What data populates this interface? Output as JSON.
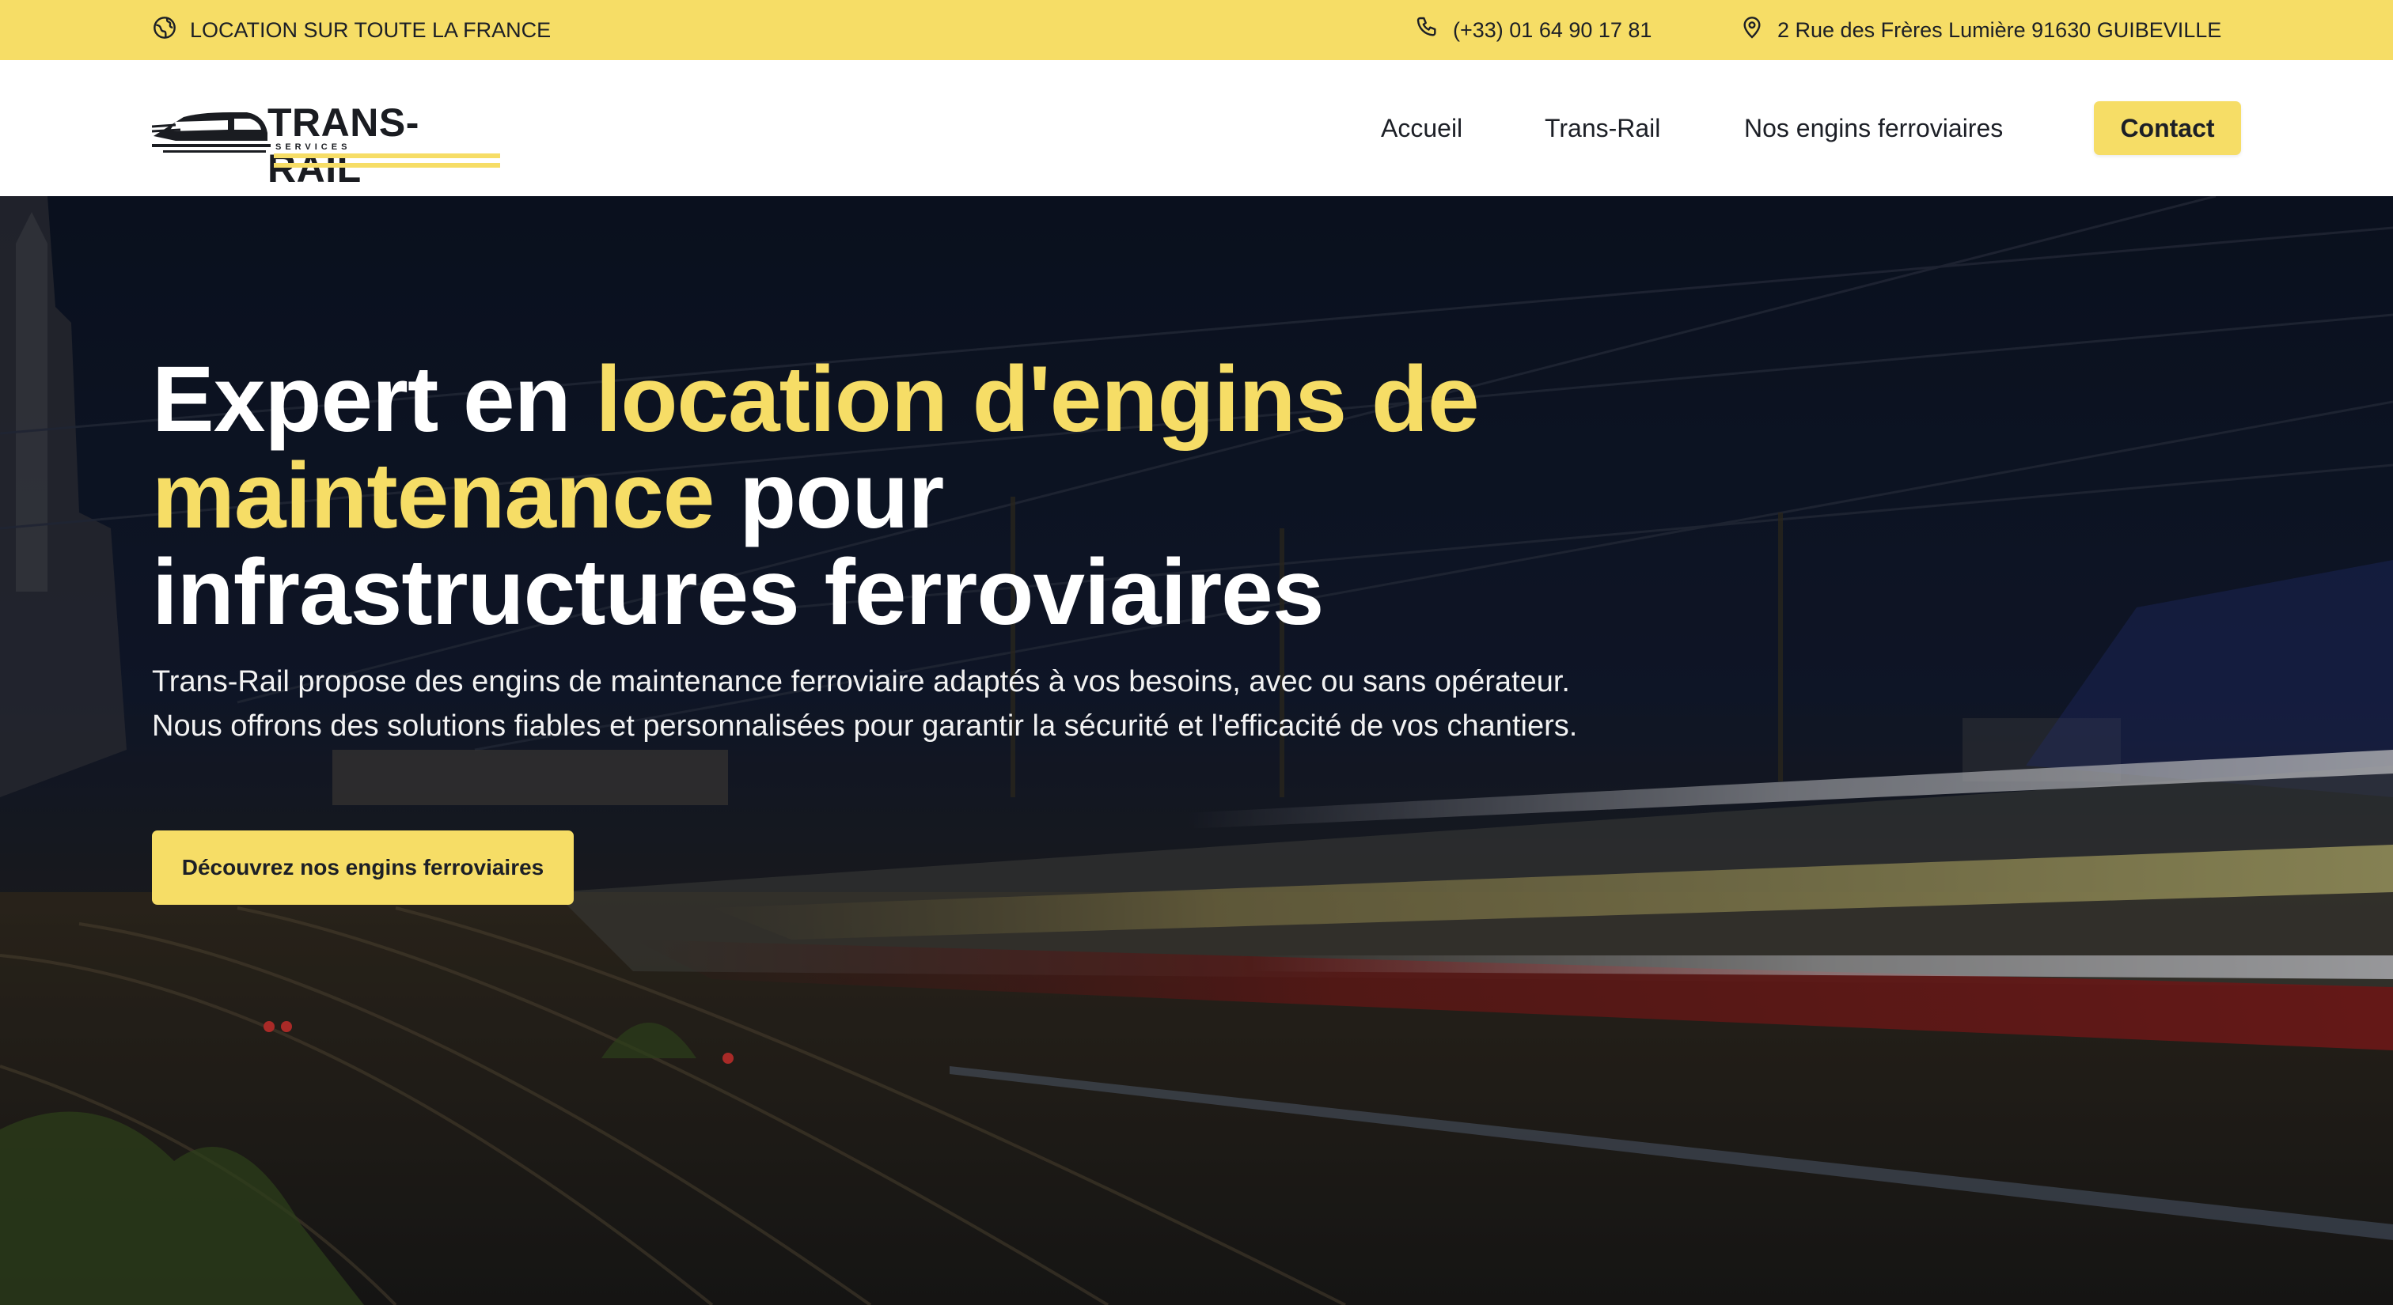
{
  "colors": {
    "accent": "#f6dd66",
    "text_dark": "#1c1f26",
    "header_bg": "#ffffff",
    "hero_text": "#ffffff"
  },
  "topbar": {
    "location_icon": "globe-icon",
    "location_text": "LOCATION SUR TOUTE LA FRANCE",
    "phone_icon": "phone-icon",
    "phone_text": "(+33) 01 64 90 17 81",
    "address_icon": "map-pin-icon",
    "address_text": "2 Rue des Frères Lumière 91630 GUIBEVILLE"
  },
  "header": {
    "logo": {
      "name": "TRANS-RAIL",
      "subtitle": "SERVICES",
      "icon": "train-icon"
    },
    "nav": {
      "accueil": "Accueil",
      "trans_rail": "Trans-Rail",
      "engins": "Nos engins ferroviaires",
      "contact": "Contact"
    }
  },
  "hero": {
    "title_part1": "Expert en ",
    "title_highlight": "location d'engins de maintenance",
    "title_part2": " pour infrastructures ferroviaires",
    "description": "Trans-Rail propose des engins de maintenance ferroviaire adaptés à vos besoins, avec ou sans opérateur. Nous offrons des solutions fiables et personnalisées pour garantir la sécurité et l'efficacité de vos chantiers.",
    "cta_label": "Découvrez nos engins ferroviaires"
  }
}
